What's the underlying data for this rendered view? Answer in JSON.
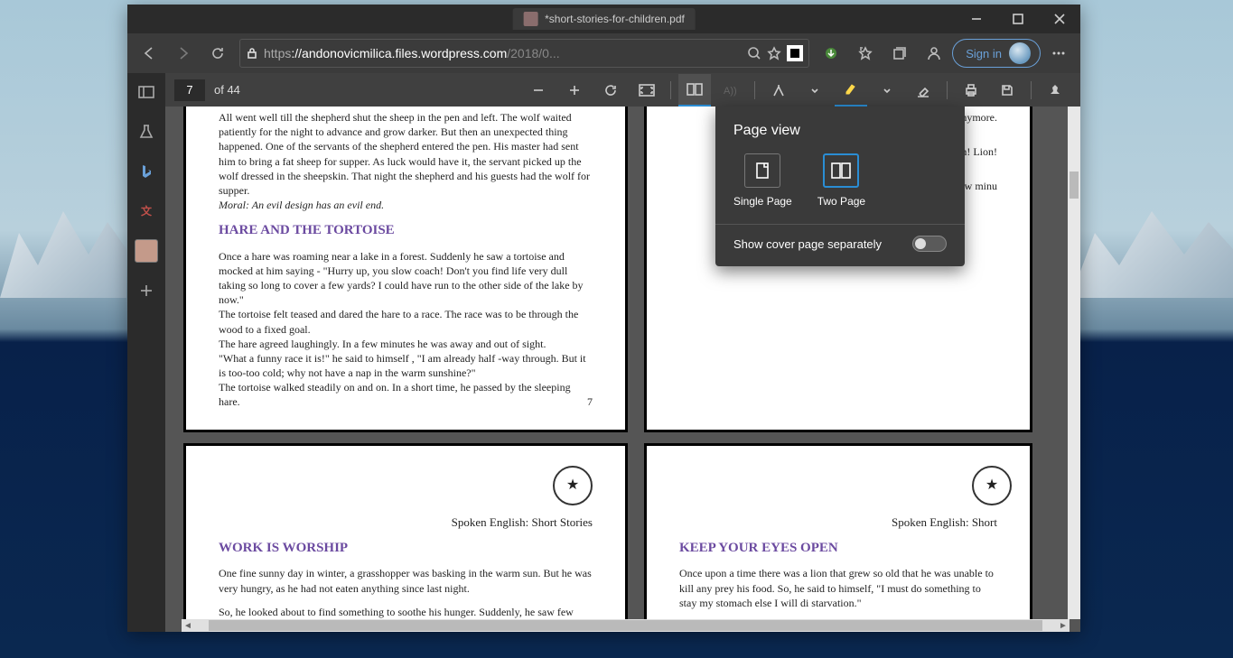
{
  "window": {
    "tab_title": "*short-stories-for-children.pdf"
  },
  "url": {
    "scheme": "https",
    "domain": "://andonovicmilica.files.wordpress.com",
    "path": "/2018/0..."
  },
  "signin": {
    "label": "Sign in"
  },
  "pdf_toolbar": {
    "current_page": "7",
    "of_label": "of 44"
  },
  "popover": {
    "title": "Page view",
    "single": "Single Page",
    "two": "Two Page",
    "cover_label": "Show cover page separately"
  },
  "pages": {
    "p7": {
      "para1": "All went well till the shepherd shut the sheep in the pen and left. The wolf waited patiently for the night to advance and grow darker. But then an unexpected thing happened. One of the servants of the shepherd entered the pen. His master had sent him to bring a fat sheep for supper. As luck would have it, the servant picked up the wolf dressed in the sheepskin. That night the shepherd and his guests had the wolf for supper.",
      "moral": "Moral: An evil design has an evil end.",
      "title2": "HARE AND THE TORTOISE",
      "para2a": "Once a hare was roaming near a lake in a forest. Suddenly he saw a tortoise and mocked at him saying - \"Hurry up, you slow coach! Don't you find life very dull taking so long to cover a few yards? I could have run to the other side of the lake by now.\"",
      "para2b": "The tortoise felt teased and dared the hare to a race. The race was to be through the wood to a fixed goal.",
      "para2c": "The hare agreed laughingly. In a few minutes he was away and out of sight.",
      "para2d": "\"What a funny race it is!\" he said to himself , \"I am already half -way through. But it is too-too cold; why not have a nap in the warm sunshine?\"",
      "para2e": "The tortoise walked steadily on and on. In a short time, he passed by the sleeping hare.",
      "page_num": "7"
    },
    "p8": {
      "frag1": "by him anymore.",
      "frag2": "w the boy shouted, \"Lion! Lion!",
      "frag3": "ave himself but within few minu"
    },
    "p9": {
      "header": "Spoken English: Short Stories",
      "title": "WORK IS WORSHIP",
      "para1": "One fine sunny day in winter, a grasshopper was basking in the warm sun. But he was very hungry, as he had not eaten anything since last night.",
      "para2": "So, he looked about to find something to soothe his hunger. Suddenly, he saw few ants carrying grains into their hole"
    },
    "p10": {
      "header": "Spoken English: Short",
      "title": "KEEP YOUR EYES OPEN",
      "para1": "Once upon a time there was a lion that grew so old that he was unable to kill any prey his food. So, he said to himself, \"I must do something to stay my stomach else I will di starvation.\""
    }
  }
}
